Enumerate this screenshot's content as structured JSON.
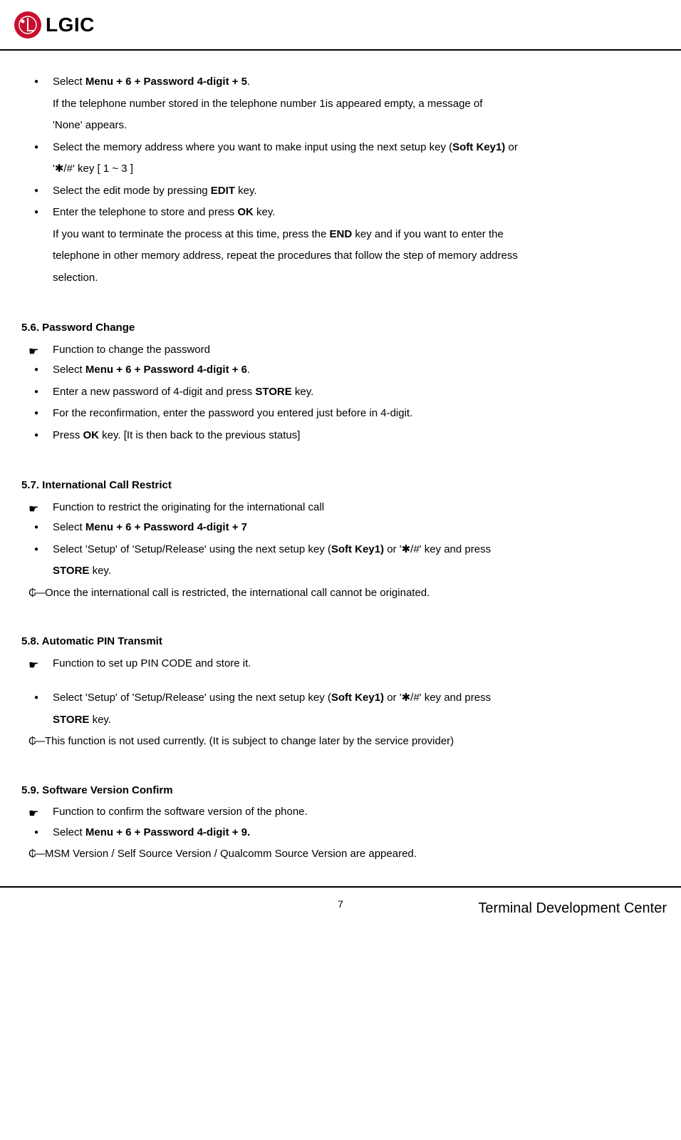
{
  "header": {
    "logo_text": "LGIC"
  },
  "s55": {
    "b1_pre": "Select ",
    "b1_bold": "Menu + 6 + Password 4-digit + 5",
    "b1_post": ".",
    "b1_cont1": "If the telephone number stored in the telephone number 1is appeared empty, a message of",
    "b1_cont2": "'None' appears.",
    "b2_pre": "Select the memory address where you want to make input using the next setup key (",
    "b2_bold": "Soft Key1)",
    "b2_post": " or",
    "b2_cont": "'✱/#' key [ 1 ~ 3 ]",
    "b3_pre": "Select the edit mode by pressing ",
    "b3_bold": "EDIT",
    "b3_post": " key.",
    "b4_pre": "Enter the telephone to store and press ",
    "b4_bold": "OK",
    "b4_post": " key.",
    "b4_cont1_a": "If you want to terminate the process at this time, press the ",
    "b4_cont1_bold": "END",
    "b4_cont1_b": " key and if you want to enter the",
    "b4_cont2": "telephone in other memory address, repeat the procedures that follow the step of memory address",
    "b4_cont3": "selection."
  },
  "s56": {
    "heading": "5.6. Password Change",
    "pointer": "Function to change the password",
    "b1_pre": "Select ",
    "b1_bold": "Menu + 6 + Password 4-digit + 6",
    "b1_post": ".",
    "b2_pre": "Enter a new password of 4-digit and press ",
    "b2_bold": "STORE",
    "b2_post": " key.",
    "b3": "For the reconfirmation, enter the password you entered just before in 4-digit.",
    "b4_pre": "Press ",
    "b4_bold": "OK",
    "b4_post": " key. [It is then back to the previous status]"
  },
  "s57": {
    "heading": "5.7. International Call Restrict",
    "pointer": "Function to restrict the originating for the international call",
    "b1_pre": "Select ",
    "b1_bold": "Menu + 6 + Password 4-digit + 7",
    "b2_a": "Select 'Setup' of 'Setup/Release' using the next setup key (",
    "b2_bold1": "Soft Key1)",
    "b2_b": " or '✱/#' key and press",
    "b2_cont_bold": "STORE",
    "b2_cont_post": " key.",
    "note_sym": "₵",
    "note": "―Once the international call is restricted, the international call cannot be originated."
  },
  "s58": {
    "heading": "5.8. Automatic PIN Transmit",
    "pointer": "Function to set up PIN CODE and store it.",
    "b1_a": "Select 'Setup' of 'Setup/Release' using the next setup key (",
    "b1_bold1": "Soft Key1)",
    "b1_b": " or '✱/#' key and press",
    "b1_cont_bold": "STORE",
    "b1_cont_post": " key.",
    "note_sym": "₵",
    "note": "―This function is not used currently. (It is subject to change later by the service provider)"
  },
  "s59": {
    "heading": "5.9.   Software Version Confirm",
    "pointer": "Function to confirm the software version of the phone.",
    "b1_pre": "Select ",
    "b1_bold": "Menu + 6 + Password 4-digit + 9.",
    "note_sym": "₵",
    "note": "―MSM Version / Self Source Version / Qualcomm Source Version are appeared."
  },
  "footer": {
    "page": "7",
    "text": "Terminal Development Center"
  }
}
